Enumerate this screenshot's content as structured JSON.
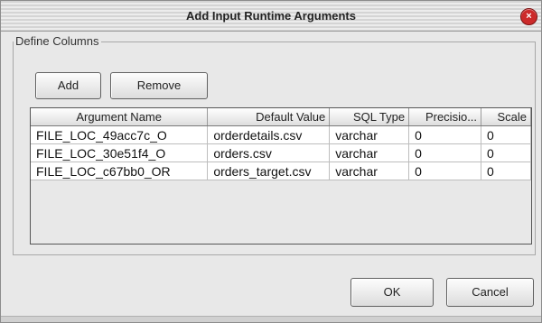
{
  "window": {
    "title": "Add Input Runtime Arguments",
    "close_label": "×"
  },
  "group": {
    "legend": "Define Columns"
  },
  "toolbar": {
    "add_label": "Add",
    "remove_label": "Remove"
  },
  "table": {
    "headers": [
      "Argument Name",
      "Default Value",
      "SQL Type",
      "Precisio...",
      "Scale"
    ],
    "rows": [
      [
        "FILE_LOC_49acc7c_O",
        "orderdetails.csv",
        "varchar",
        "0",
        "0"
      ],
      [
        "FILE_LOC_30e51f4_O",
        "orders.csv",
        "varchar",
        "0",
        "0"
      ],
      [
        "FILE_LOC_c67bb0_OR",
        "orders_target.csv",
        "varchar",
        "0",
        "0"
      ]
    ]
  },
  "footer": {
    "ok_label": "OK",
    "cancel_label": "Cancel"
  }
}
